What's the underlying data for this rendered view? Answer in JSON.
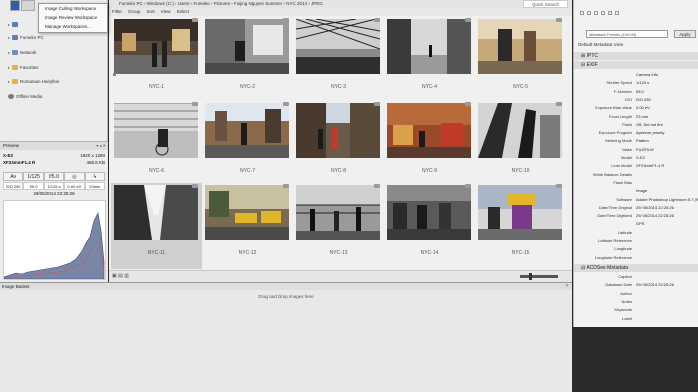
{
  "breadcrumb": "Fumeko PC  ›  Windows (C:)  ›  Users  ›  Fumeko  ›  Pictures  ›  Fuijing Nguyen Summer  ›  NYC 2014  ›  JPEG",
  "quick_search": "Quick Search",
  "filterbar": [
    "Filter",
    "Group",
    "Sort",
    "View",
    "Select"
  ],
  "workspace_menu": [
    "Image Culling Workspace",
    "Image Review Workspace",
    "Manage Workspaces..."
  ],
  "folders": [
    {
      "label": "Fumeko PC",
      "color": "#5a7fb8"
    },
    {
      "label": "Network",
      "color": "#6b8fc4"
    },
    {
      "label": "Favorites",
      "color": "#e1b43a"
    },
    {
      "label": "Romanian Hairylbin",
      "color": "#e1b43a"
    },
    {
      "label": "Offline Media",
      "color": "#7a7a7a"
    }
  ],
  "preview": {
    "title": "Preview",
    "camera": "X-E2",
    "lens": "XF23mmF1.4 R",
    "dimensions": "1920 x 1280",
    "filesize": "465.6 KB",
    "mode": "Av",
    "shutter": "1/125 s",
    "aperture": "f/5.0",
    "shutter_val": "1/125",
    "aperture_val": "f/5.0",
    "iso": "ISO 250",
    "ev": "0.00 eV",
    "focal": "23mm",
    "date": "29/05/2014 22:25:26",
    "vals_left": "ISO 250"
  },
  "thumbnails": [
    {
      "label": "NYC-1"
    },
    {
      "label": "NYC-2"
    },
    {
      "label": "NYC-3"
    },
    {
      "label": "NYC-4"
    },
    {
      "label": "NYC-5"
    },
    {
      "label": "NYC-6"
    },
    {
      "label": "NYC-7"
    },
    {
      "label": "NYC-8"
    },
    {
      "label": "NYC-9"
    },
    {
      "label": "NYC-10"
    },
    {
      "label": "NYC-11"
    },
    {
      "label": "NYC-12"
    },
    {
      "label": "NYC-13"
    },
    {
      "label": "NYC-14"
    },
    {
      "label": "NYC-15"
    }
  ],
  "bottom_panel": {
    "title": "Image Basket",
    "drop_text": "Drag and Drop images here"
  },
  "properties": {
    "preset": "Metadata Presets (Ctrl+M)",
    "apply": "Apply",
    "view": "Default Metadata View",
    "sections": {
      "iptc": "IPTC",
      "exif": "EXIF",
      "acdsee": "ACDSee Metadata"
    },
    "exif": [
      {
        "k": "",
        "v": "Camera Info"
      },
      {
        "k": "Shutter Speed",
        "v": "1/125 s"
      },
      {
        "k": "F-Number",
        "v": "f/5.0"
      },
      {
        "k": "ISO",
        "v": "ISO 250"
      },
      {
        "k": "Exposure Bias Value",
        "v": "0.00 eV"
      },
      {
        "k": "Focal Length",
        "v": "23 mm"
      },
      {
        "k": "Flash",
        "v": "Off, Did not fire"
      },
      {
        "k": "Exposure Program",
        "v": "Aperture priority"
      },
      {
        "k": "Metering Mode",
        "v": "Pattern"
      },
      {
        "k": "Make",
        "v": "FUJIFILM"
      },
      {
        "k": "Model",
        "v": "X-E2"
      },
      {
        "k": "Lens Model",
        "v": "XF23mmF1.4 R"
      },
      {
        "k": "White Balance Details",
        "v": ""
      },
      {
        "k": "Flash Bias",
        "v": ""
      },
      {
        "k": "",
        "v": "Image"
      },
      {
        "k": "Software",
        "v": "Adobe Photoshop Lightroom 5.7 (Windows)"
      },
      {
        "k": "Date/Time Original",
        "v": "29/ 05/2014 22:25:26"
      },
      {
        "k": "Date/Time Digitized",
        "v": "29/ 05/2014 22:25:26"
      },
      {
        "k": "",
        "v": "GPS"
      },
      {
        "k": "Latitude",
        "v": ""
      },
      {
        "k": "Latitude Reference",
        "v": ""
      },
      {
        "k": "Longitude",
        "v": ""
      },
      {
        "k": "Longitude Reference",
        "v": ""
      }
    ],
    "acdsee": [
      {
        "k": "Caption",
        "v": ""
      },
      {
        "k": "Database Date",
        "v": "29/ 05/2014 22:25:26"
      },
      {
        "k": "Author",
        "v": ""
      },
      {
        "k": "Notes",
        "v": ""
      },
      {
        "k": "Keywords",
        "v": ""
      },
      {
        "k": "Label",
        "v": ""
      }
    ]
  }
}
